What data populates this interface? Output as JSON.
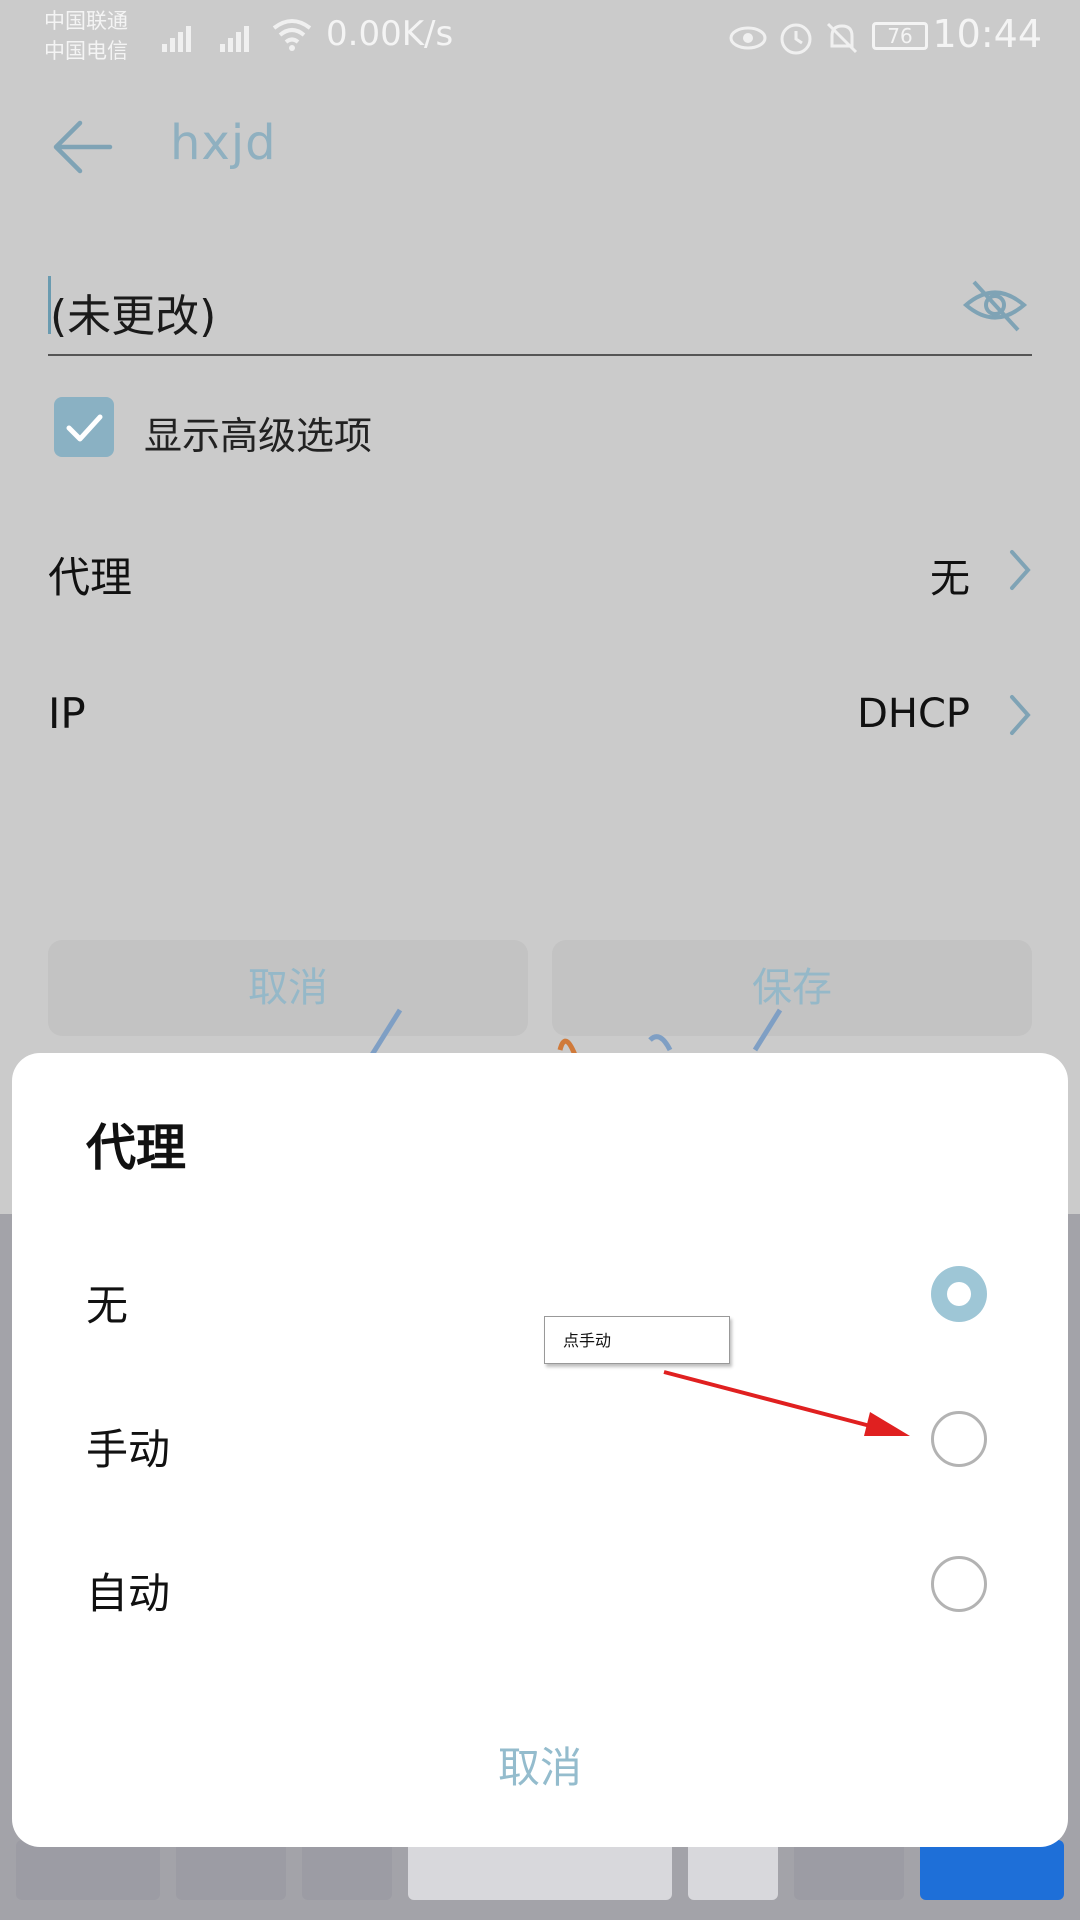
{
  "status_bar": {
    "carrier_1": "中国联通",
    "carrier_2": "中国电信",
    "net_speed": "0.00K/s",
    "battery": "76",
    "time": "10:44"
  },
  "header": {
    "title": "hxjd"
  },
  "password": {
    "value": "(未更改)"
  },
  "advanced": {
    "label": "显示高级选项",
    "checked": true
  },
  "rows": [
    {
      "label": "代理",
      "value": "无"
    },
    {
      "label": "IP",
      "value": "DHCP"
    }
  ],
  "buttons": {
    "cancel": "取消",
    "save": "保存"
  },
  "dialog": {
    "title": "代理",
    "options": [
      {
        "label": "无",
        "selected": true
      },
      {
        "label": "手动",
        "selected": false
      },
      {
        "label": "自动",
        "selected": false
      }
    ],
    "cancel": "取消"
  },
  "annotation": {
    "text": "点手动"
  },
  "colors": {
    "accent": "#8ab1c3",
    "arrow": "#e02020"
  }
}
